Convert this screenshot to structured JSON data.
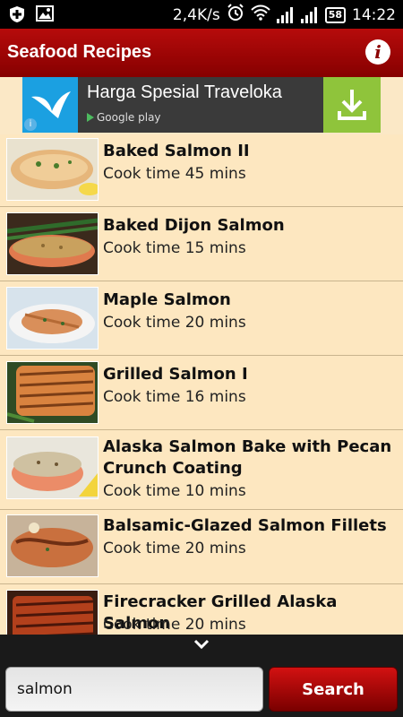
{
  "statusbar": {
    "speed": "2,4K/s",
    "battery": "58",
    "time": "14:22",
    "icons": [
      "shield-plus-icon",
      "image-icon",
      "alarm-icon",
      "wifi-icon",
      "signal-icon",
      "signal-icon",
      "battery-icon"
    ]
  },
  "appbar": {
    "title": "Seafood Recipes",
    "info_label": "i"
  },
  "ad": {
    "title": "Harga Spesial Traveloka",
    "store": "Google play",
    "info": "i"
  },
  "recipes": [
    {
      "title": "Baked Salmon II",
      "time": "Cook time 45 mins",
      "img": "salmon-herbs"
    },
    {
      "title": "Baked Dijon Salmon",
      "time": "Cook time 15 mins",
      "img": "dijon"
    },
    {
      "title": "Maple Salmon",
      "time": "Cook time 20 mins",
      "img": "maple"
    },
    {
      "title": "Grilled Salmon I",
      "time": "Cook time 16 mins",
      "img": "grilled"
    },
    {
      "title": "Alaska Salmon Bake with Pecan Crunch Coating",
      "time": "Cook time 10 mins",
      "img": "pecan"
    },
    {
      "title": "Balsamic-Glazed Salmon Fillets",
      "time": "Cook time 20 mins",
      "img": "balsamic"
    },
    {
      "title": "Firecracker Grilled Alaska Salmon",
      "time": "Cook time 20 mins",
      "img": "firecracker"
    }
  ],
  "search": {
    "value": "salmon",
    "button": "Search"
  },
  "colors": {
    "appbar": "#a00000",
    "list_bg": "#fde7c0",
    "search_button": "#b00000"
  }
}
